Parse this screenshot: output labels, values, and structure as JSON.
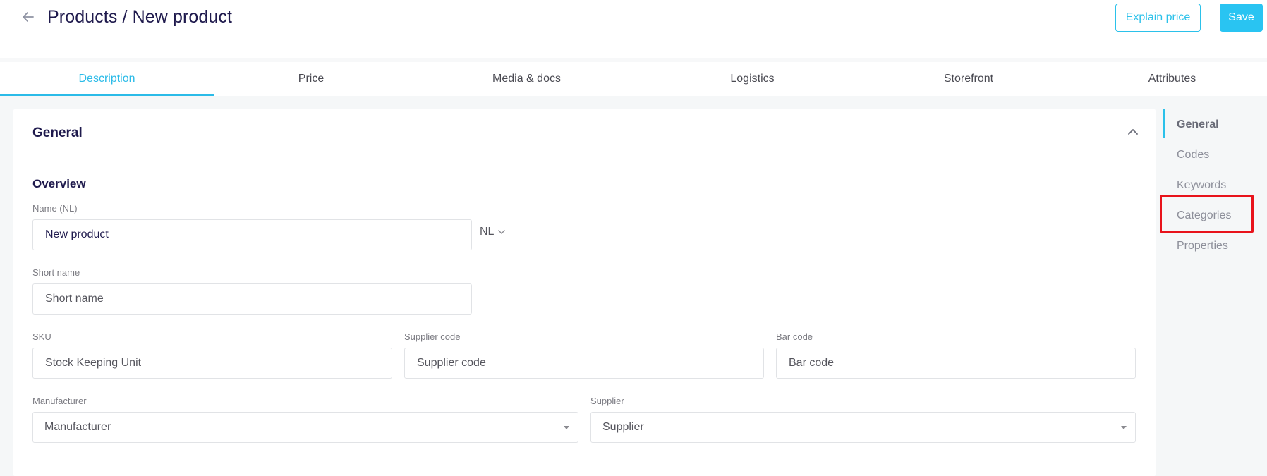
{
  "header": {
    "title": "Products / New product",
    "back_icon": "arrow-left-icon",
    "explain_price_label": "Explain price",
    "save_label": "Save"
  },
  "tabs": [
    {
      "label": "Description",
      "active": true
    },
    {
      "label": "Price",
      "active": false
    },
    {
      "label": "Media & docs",
      "active": false
    },
    {
      "label": "Logistics",
      "active": false
    },
    {
      "label": "Storefront",
      "active": false
    },
    {
      "label": "Attributes",
      "active": false
    }
  ],
  "section": {
    "title": "General",
    "collapse_icon": "chevron-up-icon",
    "subtitle": "Overview"
  },
  "fields": {
    "name": {
      "label": "Name (NL)",
      "value": "New product",
      "language": "NL"
    },
    "short_name": {
      "label": "Short name",
      "placeholder": "Short name"
    },
    "sku": {
      "label": "SKU",
      "placeholder": "Stock Keeping Unit"
    },
    "supplier_code": {
      "label": "Supplier code",
      "placeholder": "Supplier code"
    },
    "bar_code": {
      "label": "Bar code",
      "placeholder": "Bar code"
    },
    "manufacturer": {
      "label": "Manufacturer",
      "placeholder": "Manufacturer"
    },
    "supplier": {
      "label": "Supplier",
      "placeholder": "Supplier"
    }
  },
  "side_nav": {
    "items": [
      {
        "label": "General",
        "active": true
      },
      {
        "label": "Codes",
        "active": false
      },
      {
        "label": "Keywords",
        "active": false
      },
      {
        "label": "Categories",
        "active": false,
        "highlighted": true
      },
      {
        "label": "Properties",
        "active": false
      }
    ]
  },
  "colors": {
    "accent": "#2bc1ea",
    "title": "#1f1a4d",
    "highlight": "#e8131b"
  }
}
